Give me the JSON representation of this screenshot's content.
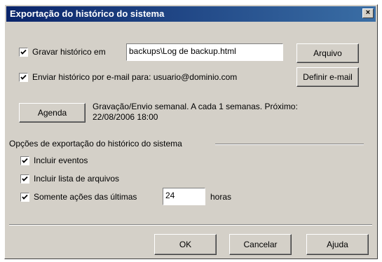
{
  "dialog": {
    "title": "Exportação do histórico do sistema",
    "close_glyph": "×"
  },
  "save_history": {
    "checked": true,
    "label": "Gravar histórico em",
    "path_value": "backups\\Log de backup.html",
    "file_button": "Arquivo"
  },
  "email_history": {
    "checked": true,
    "label": "Enviar histórico por e-mail para: usuario@dominio.com",
    "set_email_button": "Definir e-mail"
  },
  "schedule": {
    "button": "Agenda",
    "info_line1": "Gravação/Envio semanal. A cada 1 semanas. Próximo:",
    "info_line2": "22/08/2006 18:00"
  },
  "export_options": {
    "group_title": "Opções de exportação do histórico do sistema",
    "include_events": {
      "checked": true,
      "label": "Incluir eventos"
    },
    "include_files": {
      "checked": true,
      "label": "Incluir lista de arquivos"
    },
    "only_recent": {
      "checked": true,
      "label": "Somente ações das últimas",
      "hours_value": "24",
      "unit": "horas"
    }
  },
  "footer": {
    "ok": "OK",
    "cancel": "Cancelar",
    "help": "Ajuda"
  },
  "colors": {
    "title_start": "#0a246a",
    "title_end": "#3a6ea5",
    "dialog_bg": "#d4d0c8"
  },
  "icons": {
    "check": "check-icon",
    "close": "close-icon"
  }
}
